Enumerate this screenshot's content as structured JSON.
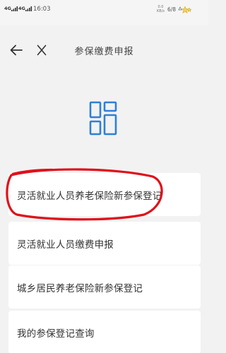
{
  "status_bar": {
    "signal1": "4G",
    "signal2": "4G",
    "time": "16:03",
    "speed_top": "0.0",
    "speed_unit": "KB/s",
    "battery": "6/8"
  },
  "header": {
    "title": "参保缴费申报",
    "back_icon": "arrow-left-icon",
    "close_icon": "close-icon"
  },
  "logo_icon": "grid-layout-icon",
  "accent_color": "#2f7fd6",
  "annotation_color": "#e0101a",
  "menu": [
    {
      "label": "灵活就业人员养老保险新参保登记",
      "highlighted": true
    },
    {
      "label": "灵活就业人员缴费申报"
    },
    {
      "label": "城乡居民养老保险新参保登记"
    },
    {
      "label": "我的参保登记查询"
    }
  ]
}
